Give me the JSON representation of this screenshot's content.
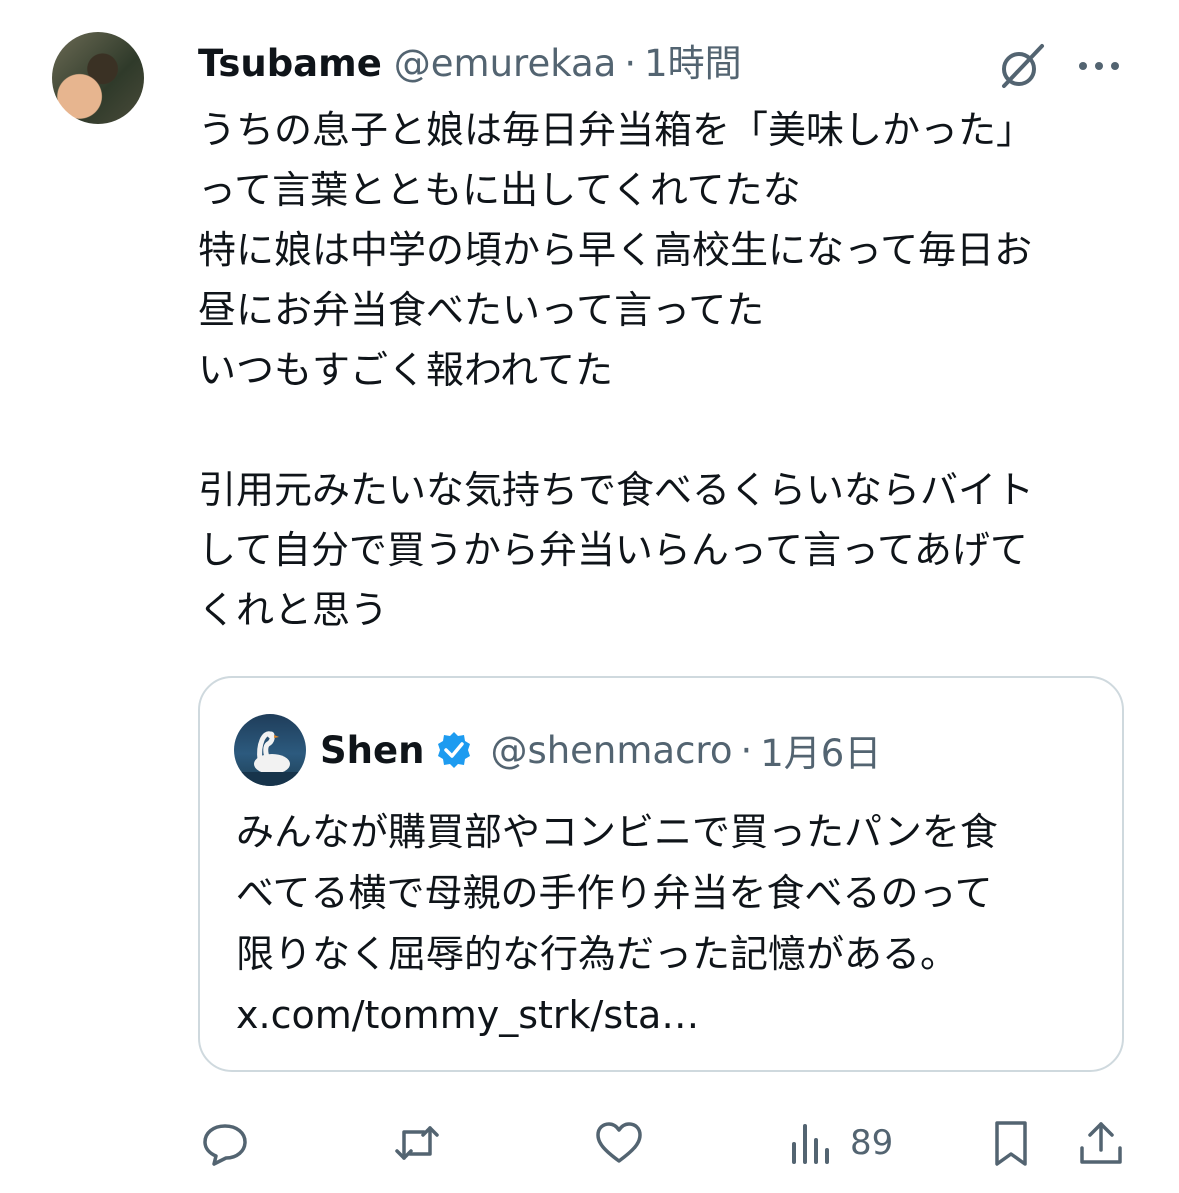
{
  "tweet": {
    "display_name": "Tsubame",
    "handle": "@emurekaa",
    "separator": "·",
    "time": "1時間",
    "text": "うちの息子と娘は毎日弁当箱を「美味しかった」\nって言葉とともに出してくれてたな\n特に娘は中学の頃から早く高校生になって毎日お\n昼にお弁当食べたいって言ってた\nいつもすごく報われてた\n\n引用元みたいな気持ちで食べるくらいならバイト\nして自分で買うから弁当いらんって言ってあげて\nくれと思う"
  },
  "quote": {
    "display_name": "Shen",
    "handle": "@shenmacro",
    "separator": "·",
    "date": "1月6日",
    "text": "みんなが購買部やコンビニで買ったパンを食\nべてる横で母親の手作り弁当を食べるのって\n限りなく屈辱的な行為だった記憶がある。\nx.com/tommy_strk/sta…"
  },
  "actions": {
    "views": "89"
  },
  "icons": {
    "grok": "grok-icon",
    "more": "more-icon",
    "verified": "verified-badge-icon",
    "reply": "reply-icon",
    "repost": "repost-icon",
    "like": "like-icon",
    "views": "views-icon",
    "bookmark": "bookmark-icon",
    "share": "share-icon"
  },
  "colors": {
    "text": "#0f1419",
    "secondary": "#536471",
    "verified": "#1d9bf0",
    "border": "#cfd9de"
  }
}
